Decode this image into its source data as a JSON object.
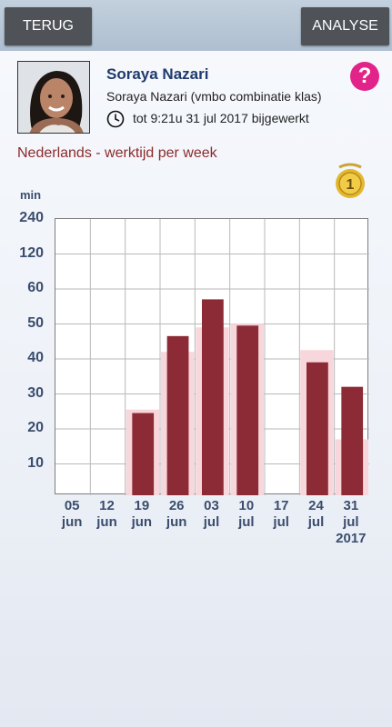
{
  "header": {
    "back_label": "TERUG",
    "analyse_label": "ANALYSE"
  },
  "profile": {
    "name": "Soraya Nazari",
    "class_line": "Soraya Nazari (vmbo combinatie klas)",
    "updated_text": "tot 9:21u 31 jul 2017 bijgewerkt",
    "help_symbol": "?"
  },
  "chart_title": "Nederlands - werktijd per week",
  "chart_data": {
    "type": "bar",
    "ylabel": "min",
    "y_ticks": [
      "240",
      "120",
      "60",
      "50",
      "40",
      "30",
      "20",
      "10"
    ],
    "categories": [
      "05 jun",
      "12 jun",
      "19 jun",
      "26 jun",
      "03 jul",
      "10 jul",
      "17 jul",
      "24 jul",
      "31 jul 2017"
    ],
    "category_lines": [
      [
        "05",
        "jun"
      ],
      [
        "12",
        "jun"
      ],
      [
        "19",
        "jun"
      ],
      [
        "26",
        "jun"
      ],
      [
        "03",
        "jul"
      ],
      [
        "10",
        "jul"
      ],
      [
        "17",
        "jul"
      ],
      [
        "24",
        "jul"
      ],
      [
        "31",
        "jul",
        "2017"
      ]
    ],
    "series": [
      {
        "values": [
          0,
          0,
          23.5,
          45.5,
          56,
          48.5,
          0,
          38,
          31
        ],
        "color": "#8c2b35"
      },
      {
        "values": [
          0,
          0,
          24.5,
          41,
          48,
          49,
          0,
          41.5,
          16
        ],
        "color": "#f7d7dc"
      }
    ],
    "grid": true
  },
  "colors": {
    "accent": "#e2248a",
    "bar": "#8c2b35",
    "bar_background": "#f7d7dc",
    "title": "#1f3a6e",
    "subject": "#8c2b2b"
  },
  "icons": {
    "clock": "clock-icon",
    "help": "help-icon",
    "medal": "medal-icon"
  },
  "medal_number": "1"
}
